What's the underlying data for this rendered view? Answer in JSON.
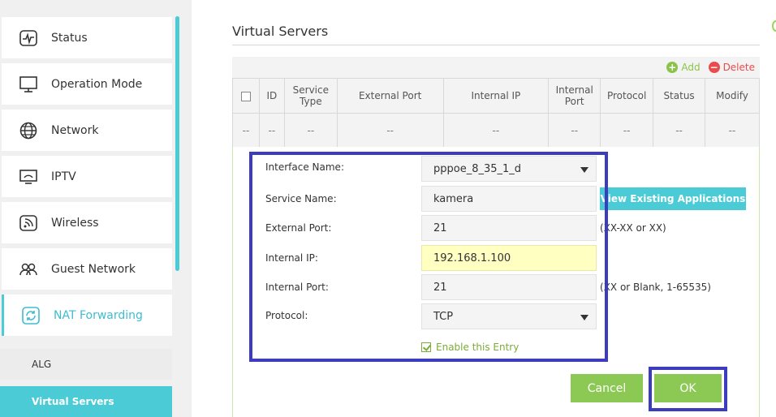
{
  "sidebar": {
    "items": [
      {
        "label": "Status",
        "icon": "pulse-icon"
      },
      {
        "label": "Operation Mode",
        "icon": "monitor-icon"
      },
      {
        "label": "Network",
        "icon": "globe-icon"
      },
      {
        "label": "IPTV",
        "icon": "tv-icon"
      },
      {
        "label": "Wireless",
        "icon": "wireless-icon"
      },
      {
        "label": "Guest Network",
        "icon": "guest-icon"
      },
      {
        "label": "NAT Forwarding",
        "icon": "refresh-icon"
      }
    ],
    "subitems": [
      {
        "label": "ALG"
      },
      {
        "label": "Virtual Servers"
      }
    ]
  },
  "page": {
    "title": "Virtual Servers"
  },
  "toolbar": {
    "add_label": "Add",
    "delete_label": "Delete"
  },
  "table": {
    "headers": [
      "ID",
      "Service Type",
      "External Port",
      "Internal IP",
      "Internal Port",
      "Protocol",
      "Status",
      "Modify"
    ],
    "row": [
      "--",
      "--",
      "--",
      "--",
      "--",
      "--",
      "--",
      "--",
      "--"
    ]
  },
  "form": {
    "interface_name": {
      "label": "Interface Name:",
      "value": "pppoe_8_35_1_d"
    },
    "service_name": {
      "label": "Service Name:",
      "value": "kamera"
    },
    "external_port": {
      "label": "External Port:",
      "value": "21",
      "hint": "(XX-XX or XX)"
    },
    "internal_ip": {
      "label": "Internal IP:",
      "value": "192.168.1.100"
    },
    "internal_port": {
      "label": "Internal Port:",
      "value": "21",
      "hint": "(XX or Blank, 1-65535)"
    },
    "protocol": {
      "label": "Protocol:",
      "value": "TCP"
    },
    "view_apps_label": "View Existing Applications",
    "enable_label": "Enable this Entry",
    "cancel_label": "Cancel",
    "ok_label": "OK"
  },
  "colors": {
    "accent": "#4acbd6",
    "button_green": "#8cc954",
    "delete_red": "#e94c4c",
    "highlight": "#3c3cbf"
  }
}
